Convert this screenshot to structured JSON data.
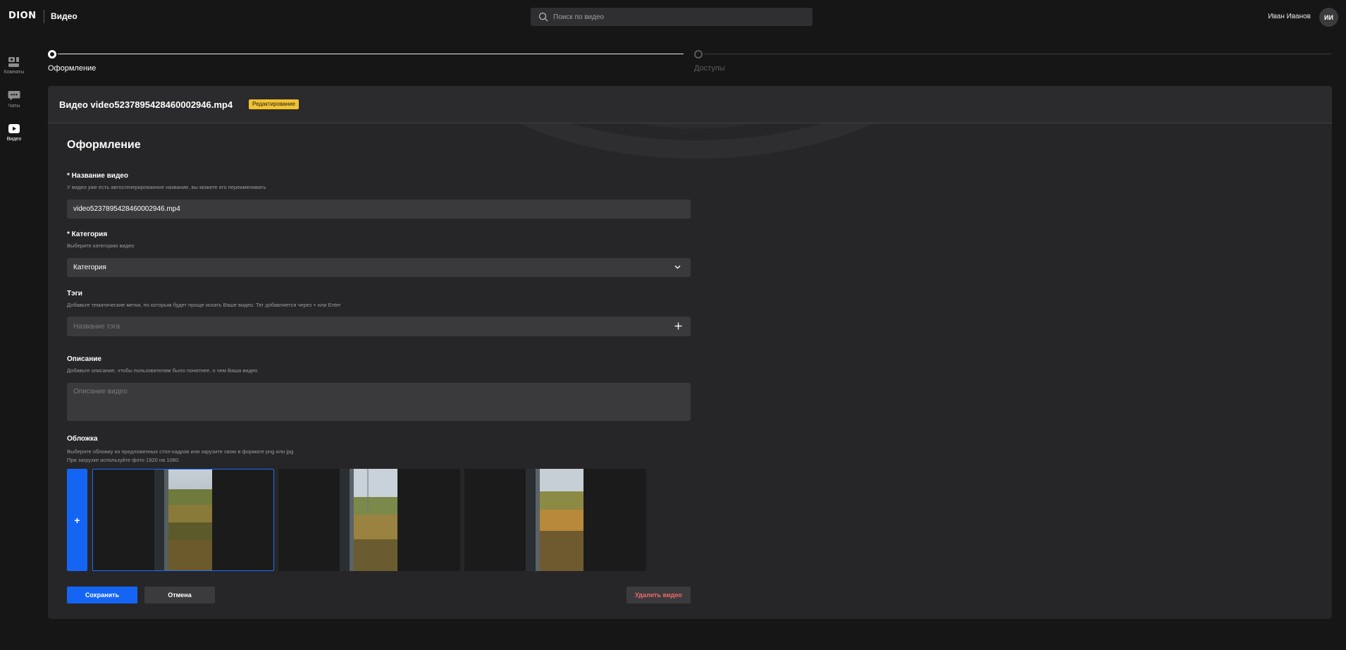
{
  "header": {
    "logo": "DION",
    "section": "Видео",
    "search_placeholder": "Поиск по видео",
    "user_name": "Иван Иванов",
    "avatar_initials": "ИИ"
  },
  "sidebar": {
    "items": [
      {
        "label": "Комнаты",
        "icon": "rooms-icon"
      },
      {
        "label": "Чаты",
        "icon": "chat-icon"
      },
      {
        "label": "Видео",
        "icon": "video-play-icon",
        "active": true
      }
    ]
  },
  "stepper": {
    "steps": [
      {
        "label": "Оформление",
        "active": true
      },
      {
        "label": "Доступы",
        "active": false
      }
    ]
  },
  "panel": {
    "video_title": "Видео video5237895428460002946.mp4",
    "badge": "Редактирование",
    "form_title": "Оформление",
    "fields": {
      "name": {
        "label": "* Название видео",
        "hint": "У видео уже есть автосгенерированное название, вы можете его переименовать",
        "value": "video5237895428460002946.mp4"
      },
      "category": {
        "label": "* Категория",
        "hint": "Выберите категорию видео",
        "value": "Категория"
      },
      "tags": {
        "label": "Тэги",
        "hint": "Добавьте тематические метки, по которым будет проще искать Ваше видео. Тег добавляется через + или Enter",
        "placeholder": "Название тэга"
      },
      "description": {
        "label": "Описание",
        "hint": "Добавьте описание, чтобы пользователям было понятнее, о чем Ваша видео",
        "placeholder": "Описание видео"
      },
      "cover": {
        "label": "Обложка",
        "hint_line1": "Выберите обложку из предложенных стоп-кадров или зарузите свою в формате png или jpg",
        "hint_line2": "При загрузке используйте фото 1920 на 1080.",
        "upload_label": "+"
      }
    },
    "buttons": {
      "save": "Сохранить",
      "cancel": "Отмена",
      "delete": "Удалить видео"
    }
  },
  "colors": {
    "background": "#161616",
    "panel": "#262628",
    "accent": "#1565f5",
    "badge": "#f2c230",
    "danger": "#f06a6a"
  }
}
